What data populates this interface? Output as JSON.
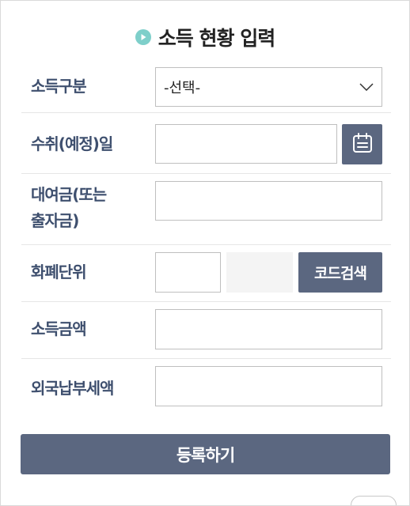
{
  "header": {
    "title": "소득 현황 입력"
  },
  "form": {
    "income_type": {
      "label": "소득구분",
      "selected": "-선택-"
    },
    "receipt_date": {
      "label": "수취(예정)일",
      "value": ""
    },
    "loan_amount": {
      "label_line1": "대여금(또는",
      "label_line2": "출자금)",
      "value": ""
    },
    "currency": {
      "label": "화폐단위",
      "code_value": "",
      "name_value": "",
      "search_label": "코드검색"
    },
    "income_amount": {
      "label": "소득금액",
      "value": ""
    },
    "foreign_tax": {
      "label": "외국납부세액",
      "value": ""
    }
  },
  "actions": {
    "submit_label": "등록하기"
  },
  "colors": {
    "accent": "#5b6780",
    "label": "#3e4f6e",
    "icon": "#7ecfca"
  }
}
